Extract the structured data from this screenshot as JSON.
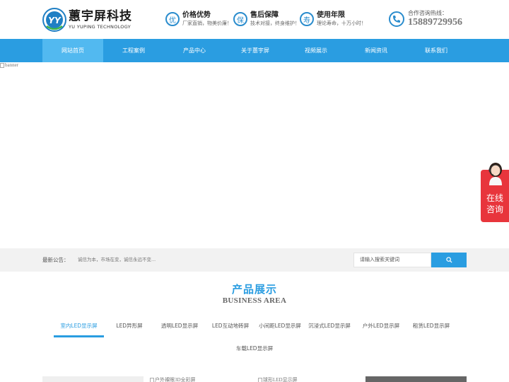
{
  "logo": {
    "mark": "YY",
    "name": "蕙宇屏科技",
    "sub": "YU YUPING TECHNOLOGY"
  },
  "features": [
    {
      "icon": "优",
      "title": "价格优势",
      "desc": "厂家直销，物美价廉！"
    },
    {
      "icon": "保",
      "title": "售后保障",
      "desc": "技术对接，终身维护！"
    },
    {
      "icon": "寿",
      "title": "使用年限",
      "desc": "理论寿命，十万小时！"
    }
  ],
  "hotline": {
    "label": "合作咨询热线：",
    "number": "15889729956"
  },
  "nav": [
    {
      "label": "网站首页",
      "active": true
    },
    {
      "label": "工程案例"
    },
    {
      "label": "产品中心"
    },
    {
      "label": "关于蕙宇屏"
    },
    {
      "label": "视频展示"
    },
    {
      "label": "新闻资讯"
    },
    {
      "label": "联系我们"
    }
  ],
  "banner": {
    "alt": "banner"
  },
  "consult": {
    "line1": "在线",
    "line2": "咨询"
  },
  "notice": {
    "label": "最新公告：",
    "text": "诚信为本，市场在变，诚信永远不变..."
  },
  "search": {
    "placeholder": "请输入搜索关键词"
  },
  "products": {
    "title": "产品展示",
    "subtitle": "BUSINESS AREA",
    "tabs": [
      "室内LED显示屏",
      "LED异形屏",
      "透明LED显示屏",
      "LED互动地砖屏",
      "小间距LED显示屏",
      "沉浸式LED显示屏",
      "户外LED显示屏",
      "租赁LED显示屏",
      "车载LED显示屏"
    ],
    "thumbs": [
      {
        "alt": ""
      },
      {
        "alt": "户外裸眼3D全彩屏"
      },
      {
        "alt": "球形LED显示屏"
      },
      {
        "alt": ""
      }
    ]
  },
  "colors": {
    "brand": "#2a9de1",
    "nav_active": "#52b9f0",
    "consult": "#e8353c"
  }
}
